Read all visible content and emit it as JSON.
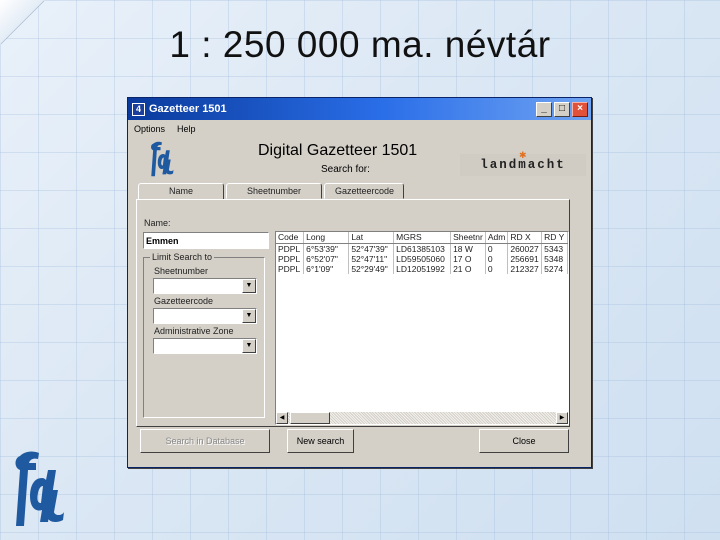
{
  "slide": {
    "title": "1 : 250 000 ma. névtár"
  },
  "window": {
    "title": "Gazetteer 1501",
    "controls": [
      "_",
      "□",
      "×"
    ],
    "menu": [
      "Options",
      "Help"
    ]
  },
  "banner": {
    "heading": "Digital Gazetteer 1501",
    "subheading": "Search for:",
    "brand": "landmacht"
  },
  "tabs": [
    "Name",
    "Sheetnumber",
    "Gazetteercode"
  ],
  "name_panel": {
    "name_label": "Name:",
    "name_value": "Emmen",
    "limit_label": "Limit Search to",
    "sheetnumber_label": "Sheetnumber",
    "gazetteercode_label": "Gazetteercode",
    "admin_zone_label": "Administrative Zone"
  },
  "results": {
    "columns": [
      "Code",
      "Long",
      "Lat",
      "MGRS",
      "Sheetnr",
      "Adm",
      "RD X",
      "RD Y"
    ],
    "rows": [
      [
        "PDPL",
        "6°53'39\"",
        "52°47'39\"",
        "LD61385103",
        "18 W",
        "0",
        "260027",
        "5343"
      ],
      [
        "PDPL",
        "6°52'07\"",
        "52°47'11\"",
        "LD59505060",
        "17 O",
        "0",
        "256691",
        "5348"
      ],
      [
        "PDPL",
        "6°1'09\"",
        "52°29'49\"",
        "LD12051992",
        "21 O",
        "0",
        "212327",
        "5274"
      ]
    ]
  },
  "buttons": {
    "search": "Search in Database",
    "new_search": "New search",
    "close": "Close"
  },
  "colors": {
    "titlebar": "#0a3a9c",
    "window_face": "#d4d0c8",
    "brand_accent": "#e07020"
  }
}
